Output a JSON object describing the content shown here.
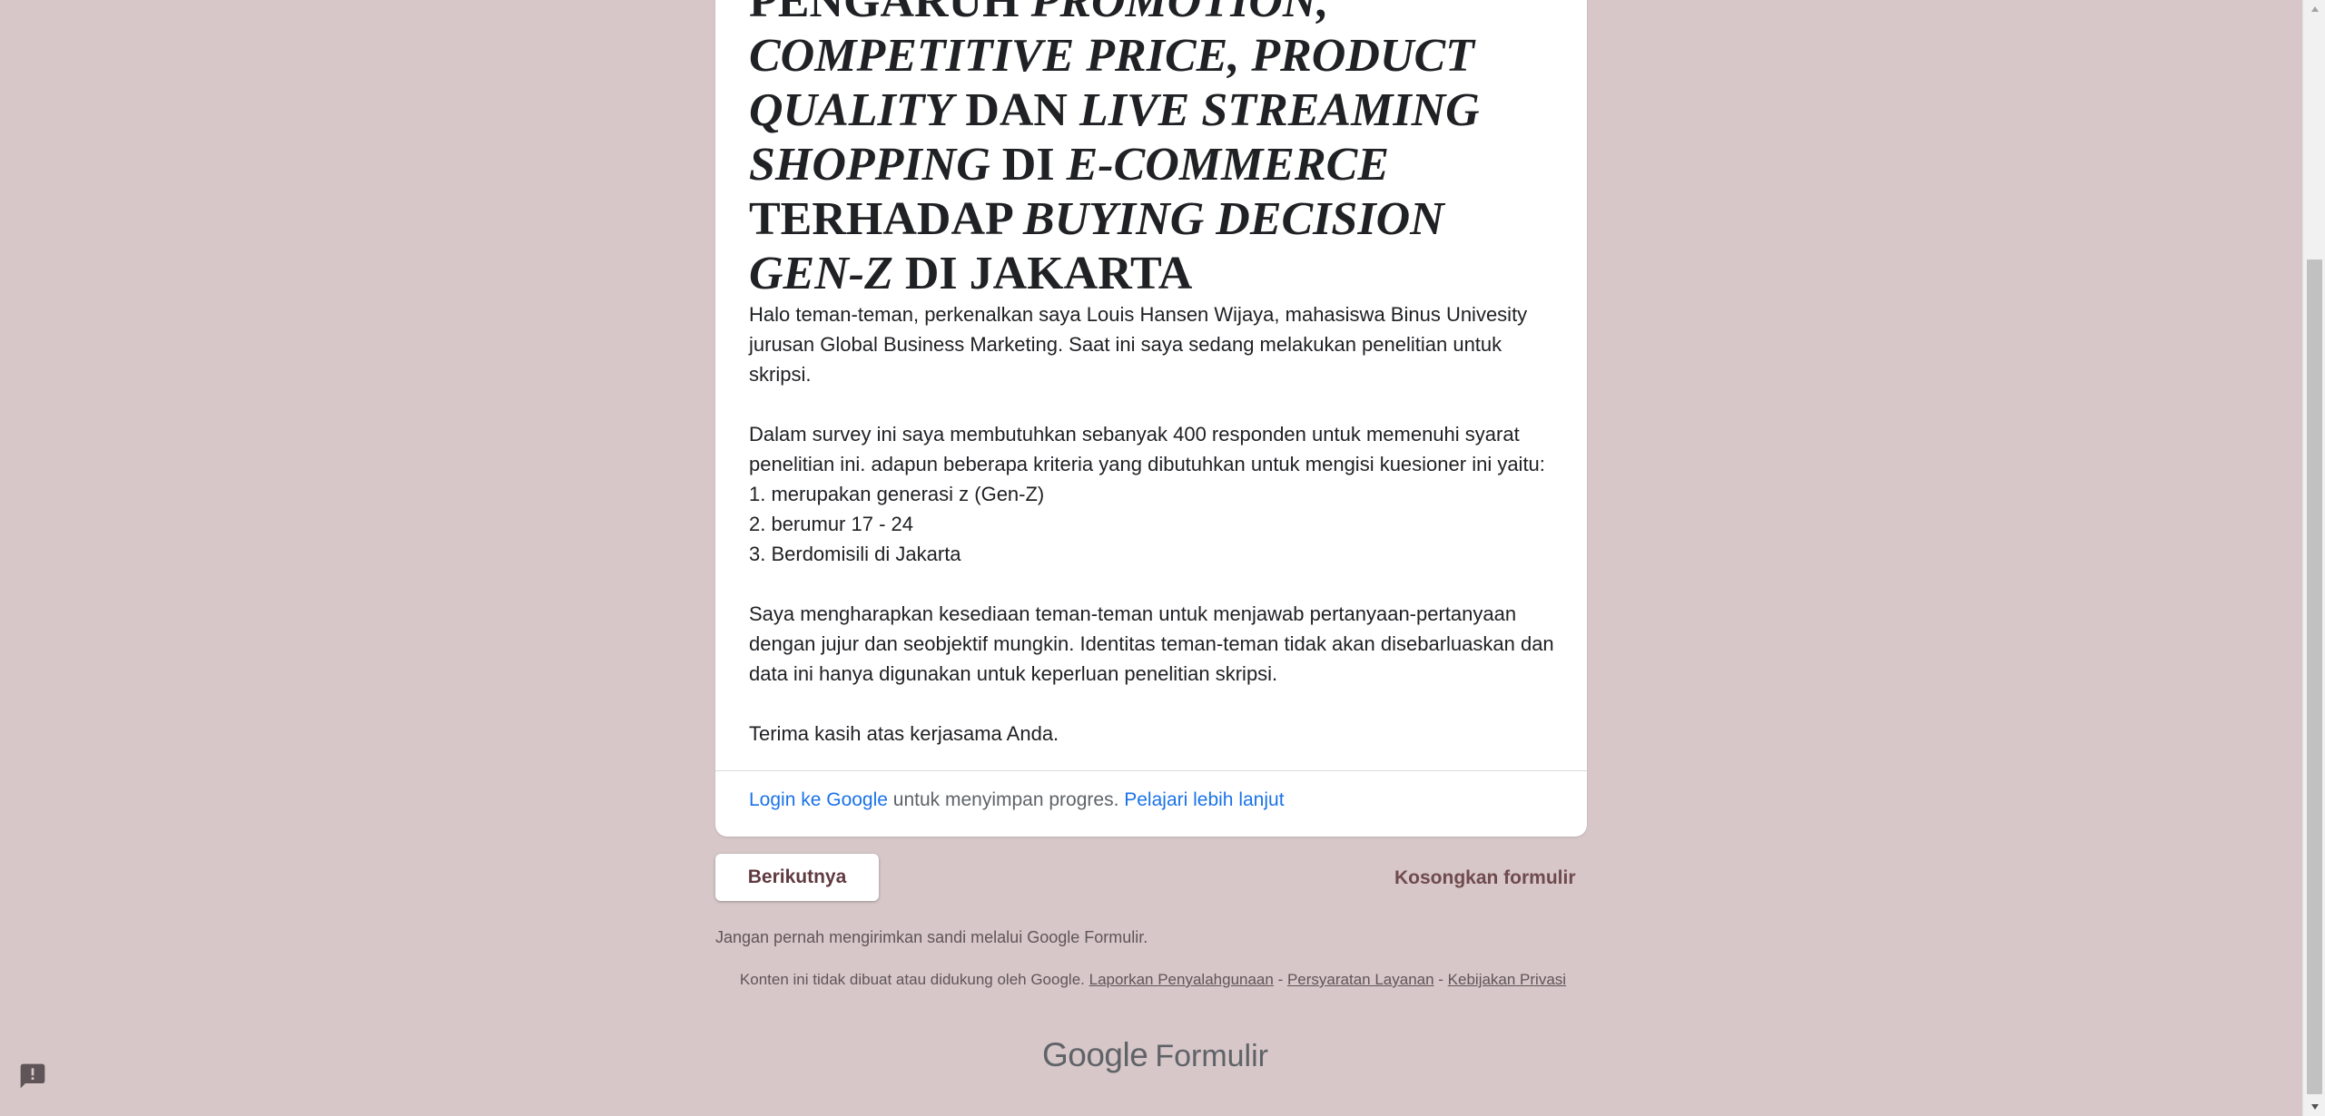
{
  "form": {
    "title_parts": {
      "p1": "PENGARUH ",
      "p2": "PROMOTION, COMPETITIVE PRICE, PRODUCT QUALITY",
      "p3": " DAN ",
      "p4": "LIVE STREAMING SHOPPING",
      "p5": " DI ",
      "p6": "E-COMMERCE",
      "p7": " TERHADAP ",
      "p8": "BUYING DECISION GEN-Z",
      "p9": " DI JAKARTA"
    },
    "description": "Halo teman-teman, perkenalkan saya Louis Hansen Wijaya, mahasiswa Binus Univesity jurusan Global Business Marketing. Saat ini saya sedang melakukan penelitian untuk skripsi.\n\nDalam survey ini saya membutuhkan sebanyak 400 responden untuk memenuhi syarat penelitian ini. adapun beberapa kriteria yang dibutuhkan untuk mengisi kuesioner ini yaitu:\n1. merupakan generasi z (Gen-Z)\n2. berumur 17 - 24\n3. Berdomisili di Jakarta\n\nSaya mengharapkan kesediaan teman-teman untuk menjawab pertanyaan-pertanyaan dengan jujur dan seobjektif mungkin. Identitas teman-teman tidak akan disebarluaskan dan data ini hanya digunakan untuk keperluan penelitian skripsi.\n\nTerima kasih atas kerjasama Anda.",
    "login_link": "Login ke Google",
    "login_suffix": " untuk menyimpan progres. ",
    "learn_more": "Pelajari lebih lanjut"
  },
  "actions": {
    "next_label": "Berikutnya",
    "clear_label": "Kosongkan formulir"
  },
  "footer": {
    "warning": "Jangan pernah mengirimkan sandi melalui Google Formulir.",
    "disclaimer": "Konten ini tidak dibuat atau didukung oleh Google. ",
    "report_abuse": "Laporkan Penyalahgunaan",
    "sep1": " - ",
    "terms": "Persyaratan Layanan",
    "sep2": " - ",
    "privacy": "Kebijakan Privasi",
    "brand_google": "Google",
    "brand_product": "Formulir"
  },
  "icons": {
    "report": "report-icon",
    "scroll_up": "arrow-up-icon",
    "scroll_down": "arrow-down-icon"
  },
  "colors": {
    "background": "#d7c7c8",
    "accent": "#6f4a4e",
    "link": "#1a73e8"
  }
}
